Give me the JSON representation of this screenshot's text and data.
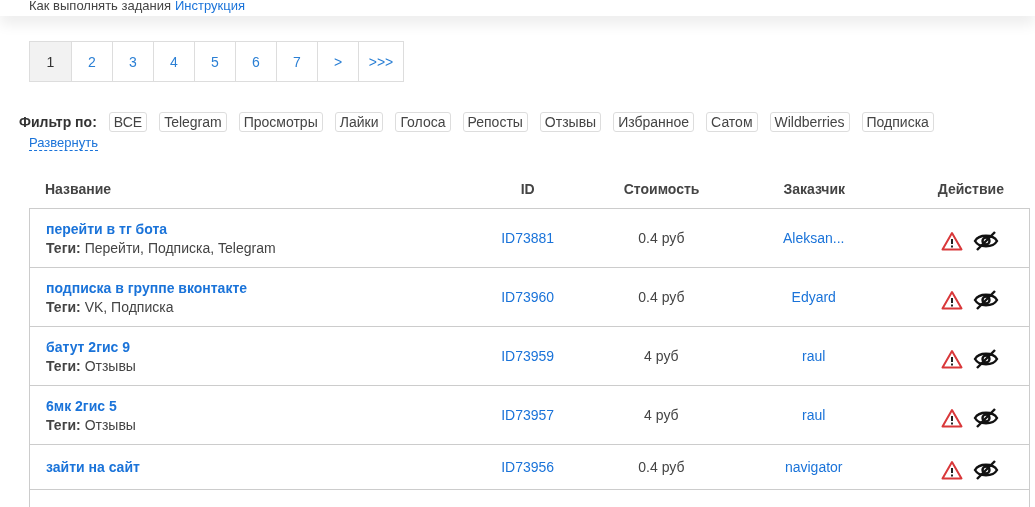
{
  "header": {
    "text": "Как выполнять задания",
    "link": "Инструкция"
  },
  "pagination": [
    {
      "label": "1",
      "selected": true
    },
    {
      "label": "2",
      "selected": false
    },
    {
      "label": "3",
      "selected": false
    },
    {
      "label": "4",
      "selected": false
    },
    {
      "label": "5",
      "selected": false
    },
    {
      "label": "6",
      "selected": false
    },
    {
      "label": "7",
      "selected": false
    },
    {
      "label": ">",
      "selected": false
    },
    {
      "label": ">>>",
      "selected": false
    }
  ],
  "filter": {
    "label": "Фильтр по:",
    "tags": [
      "ВСЕ",
      "Telegram",
      "Просмотры",
      "Лайки",
      "Голоса",
      "Репосты",
      "Отзывы",
      "Избранное",
      "Сатом",
      "Wildberries",
      "Подписка"
    ],
    "expand": "Развернуть"
  },
  "table": {
    "columns": [
      "Название",
      "ID",
      "Стоимость",
      "Заказчик",
      "Действие"
    ],
    "rows": [
      {
        "title": "перейти в тг бота",
        "tags_label": "Теги:",
        "tags": "Перейти, Подписка, Telegram",
        "id": "ID73881",
        "price": "0.4 руб",
        "customer": "Aleksan..."
      },
      {
        "title": "подписка в группе вконтакте",
        "tags_label": "Теги:",
        "tags": "VK, Подписка",
        "id": "ID73960",
        "price": "0.4 руб",
        "customer": "Edyard"
      },
      {
        "title": "батут 2гис 9",
        "tags_label": "Теги:",
        "tags": "Отзывы",
        "id": "ID73959",
        "price": "4 руб",
        "customer": "raul"
      },
      {
        "title": "6мк 2гис 5",
        "tags_label": "Теги:",
        "tags": "Отзывы",
        "id": "ID73957",
        "price": "4 руб",
        "customer": "raul"
      },
      {
        "title": "зайти на сайт",
        "id": "ID73956",
        "price": "0.4 руб",
        "customer": "navigator"
      }
    ]
  }
}
